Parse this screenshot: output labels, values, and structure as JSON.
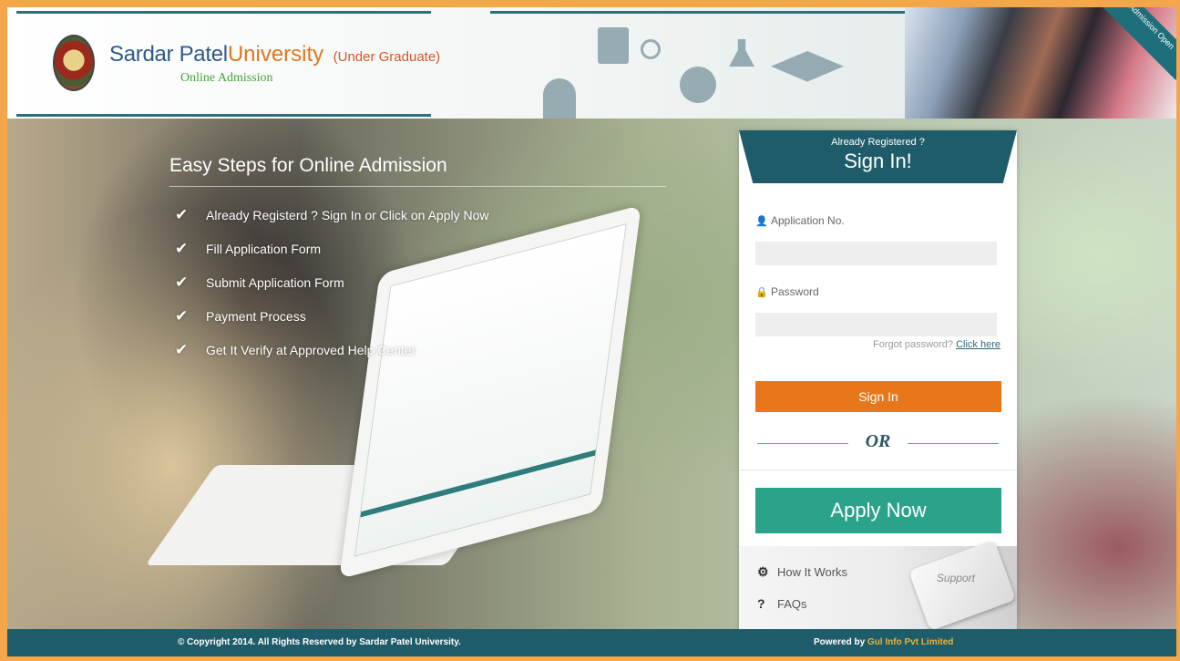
{
  "header": {
    "brand_main": "Sardar Patel ",
    "brand_accent": "University",
    "brand_sub": "(Under Graduate)",
    "brand_tag": "Online Admission",
    "ribbon": "Admission Open"
  },
  "steps": {
    "title": "Easy Steps for Online Admission",
    "items": [
      "Already Registerd ? Sign In or Click on Apply Now",
      "Fill Application Form",
      "Submit Application Form",
      "Payment Process",
      "Get It Verify at Approved Help Center"
    ]
  },
  "signin": {
    "pre": "Already Registered ?",
    "title": "Sign In!",
    "app_no_label": "Application No.",
    "password_label": "Password",
    "forgot_text": "Forgot password?",
    "forgot_link": "Click here",
    "signin_button": "Sign In",
    "or": "OR",
    "apply_button": "Apply Now",
    "how_it_works": "How It Works",
    "faqs": "FAQs",
    "support_key": "Support"
  },
  "footer": {
    "copyright": "© Copyright 2014. All Rights Reserved by Sardar Patel University.",
    "powered_by": "Powered by",
    "powered_company": "Gul Info Pvt Limited"
  },
  "colors": {
    "accent_teal": "#1f5c69",
    "signin_orange": "#e8771b",
    "apply_green": "#2aa38a"
  }
}
